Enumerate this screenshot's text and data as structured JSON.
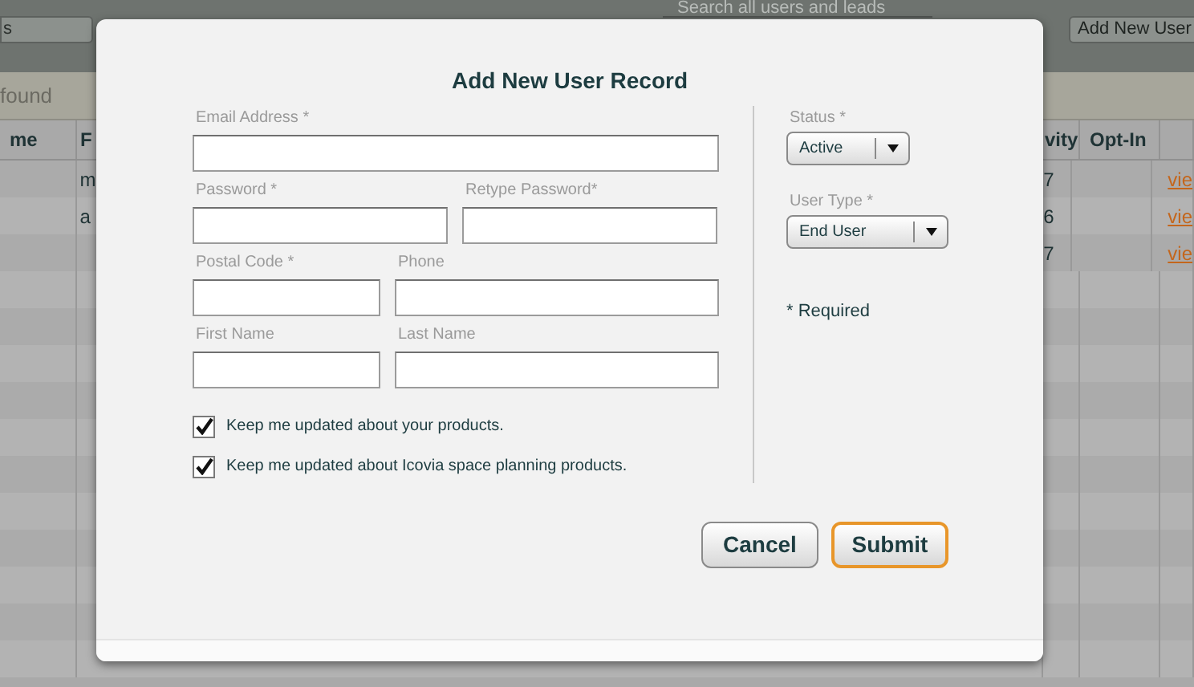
{
  "background": {
    "toolbar": {
      "left_button": "s",
      "search": {
        "placeholder": "Search all users and leads"
      },
      "add_button": "Add New User"
    },
    "results_label": "found",
    "table": {
      "columns": [
        "me",
        "F",
        "vity",
        "Opt-In"
      ],
      "rows": [
        {
          "column_2": "m",
          "column_3": "7",
          "link": "vie"
        },
        {
          "column_2": "a",
          "column_3": "6",
          "link": "vie"
        },
        {
          "column_3": "7",
          "link": "vie"
        }
      ]
    }
  },
  "dialog": {
    "title": "Add New User Record",
    "fields": [
      {
        "label": "Email Address *"
      },
      {
        "label": "Password *"
      },
      {
        "label": "Retype Password*"
      },
      {
        "label": "Postal Code *"
      },
      {
        "label": "Phone"
      },
      {
        "label": "First Name"
      },
      {
        "label": "Last Name"
      }
    ],
    "checkboxes": [
      {
        "label": "Keep me updated about your products.",
        "checked": true
      },
      {
        "label": "Keep me updated about Icovia space planning products.",
        "checked": true
      }
    ],
    "selects": [
      {
        "label": "Status *",
        "value": "Active"
      },
      {
        "label": "User Type *",
        "value": "End User"
      }
    ],
    "required_note": "* Required",
    "buttons": [
      {
        "label": "Cancel",
        "primary": false
      },
      {
        "label": "Submit",
        "primary": true
      }
    ]
  }
}
